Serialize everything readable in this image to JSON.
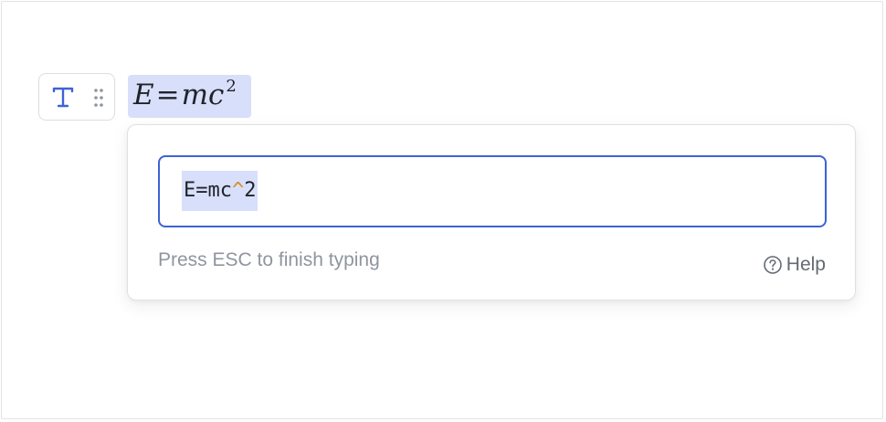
{
  "formula": {
    "lhs": "E",
    "equals": "=",
    "rhs": "mc",
    "exponent": "2"
  },
  "editor": {
    "input_parts": {
      "before": "E=mc",
      "operator": "^",
      "after": "2"
    },
    "hint": "Press ESC to finish typing",
    "help_label": "Help"
  },
  "icons": {
    "block_type": "text-type-icon",
    "drag": "drag-handle-icon",
    "help": "help-circle-icon"
  },
  "colors": {
    "accent": "#3d63d4",
    "selection": "#d8dffa",
    "operator": "#d88c29"
  }
}
